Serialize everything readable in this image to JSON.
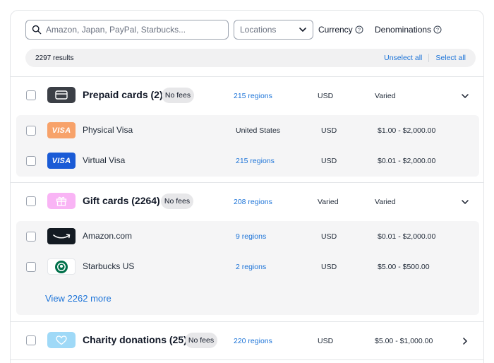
{
  "search": {
    "placeholder": "Amazon, Japan, PayPal, Starbucks..."
  },
  "filters": {
    "locations_placeholder": "Locations",
    "currency_label": "Currency",
    "denominations_label": "Denominations"
  },
  "results": {
    "count": "2297 results",
    "unselect_all": "Unselect all",
    "select_all": "Select all"
  },
  "categories": [
    {
      "name": "Prepaid cards (2)",
      "badge": "No fees",
      "regions": "215 regions",
      "currency": "USD",
      "denominations": "Varied",
      "expanded": true,
      "items": [
        {
          "name": "Physical Visa",
          "regions": "United States",
          "currency": "USD",
          "denominations": "$1.00 - $2,000.00",
          "icon": "visa-logo-orange"
        },
        {
          "name": "Virtual Visa",
          "regions": "215 regions",
          "currency": "USD",
          "denominations": "$0.01 - $2,000.00",
          "icon": "visa-logo-blue"
        }
      ]
    },
    {
      "name": "Gift cards (2264)",
      "badge": "No fees",
      "regions": "208 regions",
      "currency": "Varied",
      "denominations": "Varied",
      "expanded": true,
      "items": [
        {
          "name": "Amazon.com",
          "regions": "9 regions",
          "currency": "USD",
          "denominations": "$0.01 - $2,000.00",
          "icon": "amazon-logo"
        },
        {
          "name": "Starbucks US",
          "regions": "2 regions",
          "currency": "USD",
          "denominations": "$5.00 - $500.00",
          "icon": "starbucks-logo"
        }
      ],
      "view_more": "View 2262 more"
    },
    {
      "name": "Charity donations (25)",
      "badge": "No fees",
      "regions": "220 regions",
      "currency": "USD",
      "denominations": "$5.00 - $1,000.00",
      "expanded": false
    }
  ],
  "visa_text": "VISA",
  "colors": {
    "accent": "#1d74d8",
    "prepaid_icon_bg": "#3b3f46",
    "gift_icon_bg": "#f9b4f5",
    "charity_icon_bg": "#9fd9f7",
    "visa_orange": "#f7a26a",
    "visa_blue": "#1a5bd6"
  }
}
